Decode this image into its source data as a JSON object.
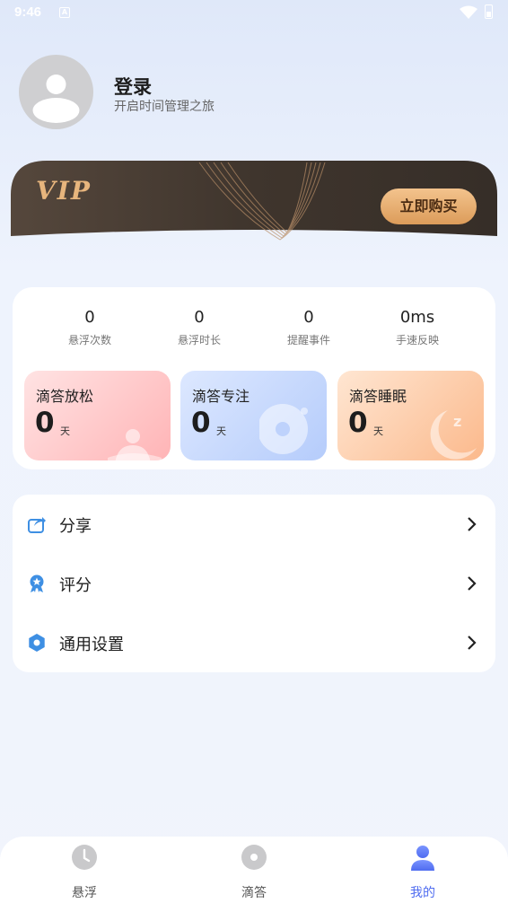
{
  "status_bar": {
    "time": "9:46"
  },
  "profile": {
    "title": "登录",
    "subtitle": "开启时间管理之旅"
  },
  "vip": {
    "label": "VIP",
    "button": "立即购买"
  },
  "stats": [
    {
      "value": "0",
      "label": "悬浮次数"
    },
    {
      "value": "0",
      "label": "悬浮时长"
    },
    {
      "value": "0",
      "label": "提醒事件"
    },
    {
      "value": "0ms",
      "label": "手速反映"
    }
  ],
  "cards": [
    {
      "title": "滴答放松",
      "value": "0",
      "unit": "天"
    },
    {
      "title": "滴答专注",
      "value": "0",
      "unit": "天"
    },
    {
      "title": "滴答睡眠",
      "value": "0",
      "unit": "天"
    }
  ],
  "menu": [
    {
      "label": "分享",
      "icon": "share-icon"
    },
    {
      "label": "评分",
      "icon": "award-icon"
    },
    {
      "label": "通用设置",
      "icon": "gear-icon"
    }
  ],
  "nav": [
    {
      "label": "悬浮",
      "icon": "clock-icon"
    },
    {
      "label": "滴答",
      "icon": "disc-icon"
    },
    {
      "label": "我的",
      "icon": "person-icon",
      "active": true
    }
  ],
  "colors": {
    "accent": "#4f6cf0",
    "vip_gold": "#e7b57d"
  }
}
